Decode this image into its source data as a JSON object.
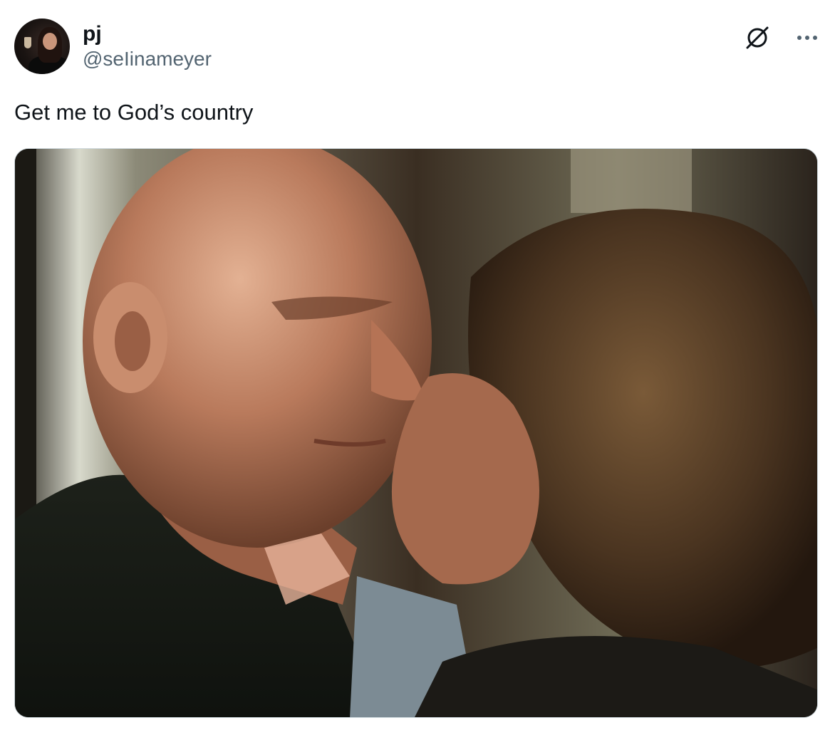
{
  "tweet": {
    "display_name": "pj",
    "handle": "@seIinameyer",
    "text": "Get me to God’s country",
    "avatar_icon": "profile-photo",
    "grok_icon": "grok-icon",
    "more_icon": "more-icon"
  },
  "colors": {
    "text_primary": "#0f1419",
    "text_secondary": "#536471",
    "border": "#cfd9de"
  }
}
